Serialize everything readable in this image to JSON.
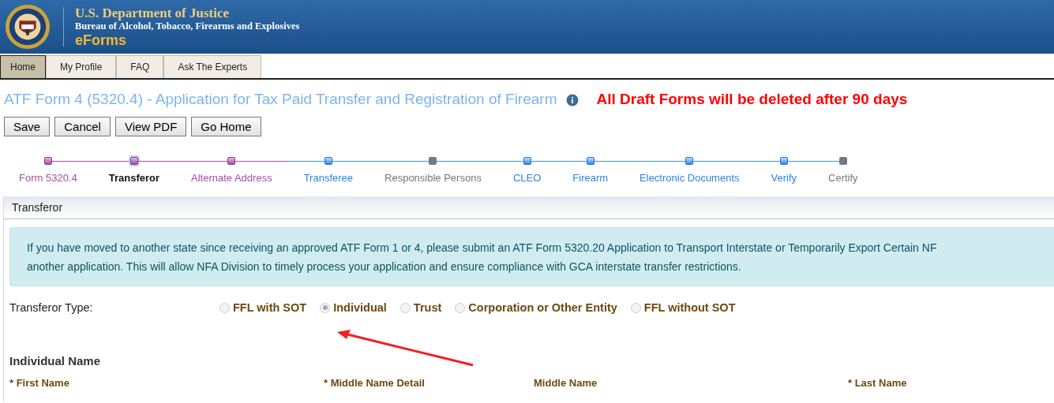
{
  "header": {
    "title": "U.S. Department of Justice",
    "subtitle": "Bureau of Alcohol, Tobacco, Firearms and Explosives",
    "app": "eForms"
  },
  "tabs": [
    {
      "label": "Home",
      "selected": true
    },
    {
      "label": "My Profile",
      "selected": false
    },
    {
      "label": "FAQ",
      "selected": false
    },
    {
      "label": "Ask The Experts",
      "selected": false
    }
  ],
  "page_title": "ATF Form 4 (5320.4) - Application for Tax Paid Transfer and Registration of Firearm",
  "notice": "All Draft Forms will be deleted after 90 days",
  "buttons": [
    "Save",
    "Cancel",
    "View PDF",
    "Go Home"
  ],
  "steps": [
    {
      "label": "Form 5320.4",
      "kind": "done",
      "selected": false
    },
    {
      "label": "Transferor",
      "kind": "done",
      "selected": true
    },
    {
      "label": "Alternate Address",
      "kind": "done",
      "selected": false
    },
    {
      "label": "Transferee",
      "kind": "pending",
      "selected": false
    },
    {
      "label": "Responsible Persons",
      "kind": "locked",
      "selected": false
    },
    {
      "label": "CLEO",
      "kind": "pending",
      "selected": false
    },
    {
      "label": "Firearm",
      "kind": "pending",
      "selected": false
    },
    {
      "label": "Electronic Documents",
      "kind": "pending",
      "selected": false
    },
    {
      "label": "Verify",
      "kind": "pending",
      "selected": false
    },
    {
      "label": "Certify",
      "kind": "locked",
      "selected": false
    }
  ],
  "section": {
    "title": "Transferor",
    "alert_lines": [
      "If you have moved to another state since receiving an approved ATF Form 1 or 4, please submit an ATF Form 5320.20 Application to Transport Interstate or Temporarily Export Certain NF",
      "another application. This will allow NFA Division to timely process your application and ensure compliance with GCA interstate transfer restrictions."
    ],
    "type_label": "Transferor Type:",
    "type_options": [
      {
        "label": "FFL with SOT",
        "selected": false
      },
      {
        "label": "Individual",
        "selected": true
      },
      {
        "label": "Trust",
        "selected": false
      },
      {
        "label": "Corporation or Other Entity",
        "selected": false
      },
      {
        "label": "FFL without SOT",
        "selected": false
      }
    ],
    "name_heading": "Individual Name",
    "name_fields": [
      "* First Name",
      "* Middle Name Detail",
      "Middle Name",
      "* Last Name"
    ]
  }
}
